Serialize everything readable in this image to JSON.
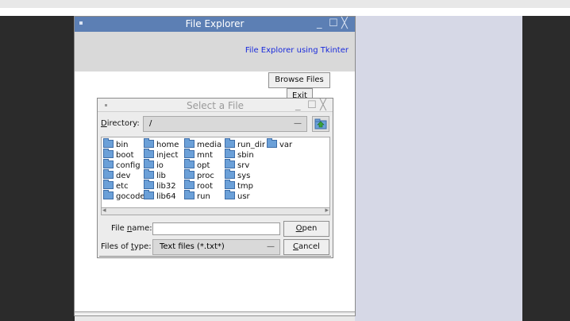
{
  "main_window": {
    "title": "File Explorer",
    "controls": [
      "_",
      "☐",
      "╳"
    ],
    "subtitle": "File Explorer using Tkinter",
    "browse_label": "Browse Files",
    "exit_label": "Exit"
  },
  "dialog": {
    "title": "Select a File",
    "controls": [
      "_",
      "☐",
      "╳"
    ],
    "directory_label_mnemonic": "D",
    "directory_label_rest": "irectory:",
    "directory_value": "/",
    "combo_arrow": "—",
    "folders": [
      [
        "bin",
        "boot",
        "config",
        "dev",
        "etc",
        "gocode"
      ],
      [
        "home",
        "inject",
        "io",
        "lib",
        "lib32",
        "lib64"
      ],
      [
        "media",
        "mnt",
        "opt",
        "proc",
        "root",
        "run"
      ],
      [
        "run_dir",
        "sbin",
        "srv",
        "sys",
        "tmp",
        "usr"
      ],
      [
        "var"
      ]
    ],
    "scroll_left": "◂",
    "scroll_right": "▸",
    "file_name_label_pre": "File ",
    "file_name_label_mnemonic": "n",
    "file_name_label_post": "ame:",
    "file_name_value": "",
    "files_of_type_label_pre": "Files of ",
    "files_of_type_label_mnemonic": "t",
    "files_of_type_label_post": "ype:",
    "files_of_type_value": "Text files (*.txt*)",
    "open_mnemonic": "O",
    "open_rest": "pen",
    "cancel_mnemonic": "C",
    "cancel_rest": "ancel"
  },
  "icons": {
    "folder": "folder-icon",
    "up_folder": "folder-up-icon"
  }
}
